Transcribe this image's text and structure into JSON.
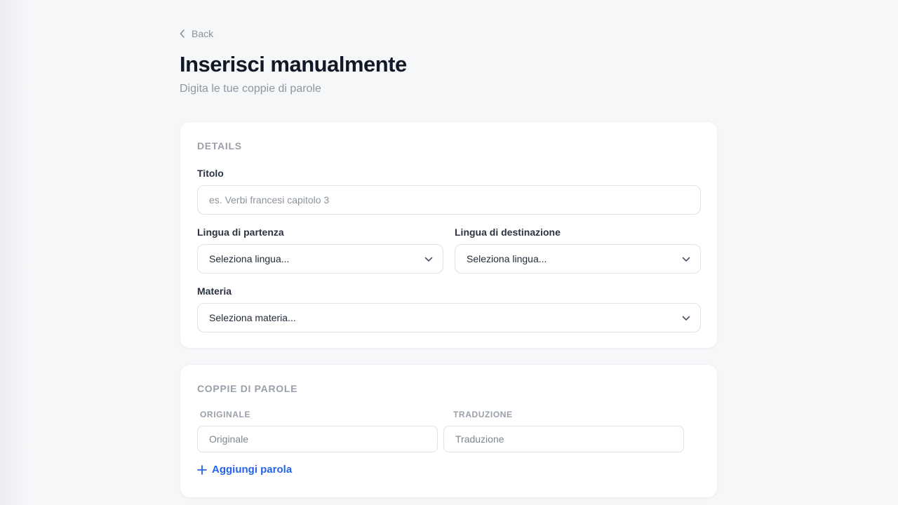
{
  "nav": {
    "back_label": "Back"
  },
  "header": {
    "title": "Inserisci manualmente",
    "subtitle": "Digita le tue coppie di parole"
  },
  "details": {
    "section_label": "DETAILS",
    "title_label": "Titolo",
    "title_placeholder": "es. Verbi francesi capitolo 3",
    "title_value": "",
    "source_lang_label": "Lingua di partenza",
    "source_lang_value": "Seleziona lingua...",
    "target_lang_label": "Lingua di destinazione",
    "target_lang_value": "Seleziona lingua...",
    "subject_label": "Materia",
    "subject_value": "Seleziona materia..."
  },
  "pairs": {
    "section_label": "COPPIE DI PAROLE",
    "original_header": "ORIGINALE",
    "translation_header": "TRADUZIONE",
    "rows": [
      {
        "original_placeholder": "Originale",
        "translation_placeholder": "Traduzione"
      }
    ],
    "add_label": "Aggiungi parola"
  },
  "icons": {
    "back": "chevron-left-icon",
    "select": "chevron-down-icon",
    "add": "plus-icon"
  },
  "colors": {
    "accent": "#2563eb",
    "background": "#f6f7f9",
    "card": "#ffffff"
  }
}
